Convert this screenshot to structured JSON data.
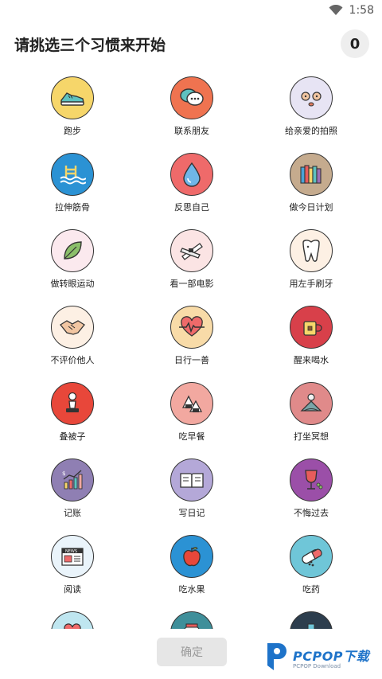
{
  "status": {
    "time": "1:58"
  },
  "header": {
    "title": "请挑选三个习惯来开始",
    "selected_count": "0"
  },
  "icons": {
    "news_text": "NEWS"
  },
  "habits": [
    {
      "label": "跑步",
      "icon": "sneaker-icon"
    },
    {
      "label": "联系朋友",
      "icon": "chat-bubbles-icon"
    },
    {
      "label": "给亲爱的拍照",
      "icon": "cute-face-icon"
    },
    {
      "label": "拉伸筋骨",
      "icon": "swimming-pool-icon"
    },
    {
      "label": "反思自己",
      "icon": "water-drop-icon"
    },
    {
      "label": "做今日计划",
      "icon": "books-icon"
    },
    {
      "label": "做转眼运动",
      "icon": "leaf-icon"
    },
    {
      "label": "看一部电影",
      "icon": "film-strip-icon"
    },
    {
      "label": "用左手刷牙",
      "icon": "tooth-icon"
    },
    {
      "label": "不评价他人",
      "icon": "handshake-icon"
    },
    {
      "label": "日行一善",
      "icon": "heartbeat-icon"
    },
    {
      "label": "醒来喝水",
      "icon": "mug-icon"
    },
    {
      "label": "叠被子",
      "icon": "chess-pawn-icon"
    },
    {
      "label": "吃早餐",
      "icon": "rice-ball-icon"
    },
    {
      "label": "打坐冥想",
      "icon": "meditation-icon"
    },
    {
      "label": "记账",
      "icon": "chart-growth-icon"
    },
    {
      "label": "写日记",
      "icon": "open-book-icon"
    },
    {
      "label": "不悔过去",
      "icon": "wine-glass-icon"
    },
    {
      "label": "阅读",
      "icon": "newspaper-icon"
    },
    {
      "label": "吃水果",
      "icon": "apple-icon"
    },
    {
      "label": "吃药",
      "icon": "pill-icon"
    }
  ],
  "footer": {
    "confirm_label": "确定"
  },
  "watermark": {
    "title": "PCPOP下载",
    "subtitle": "PCPOP Download"
  }
}
